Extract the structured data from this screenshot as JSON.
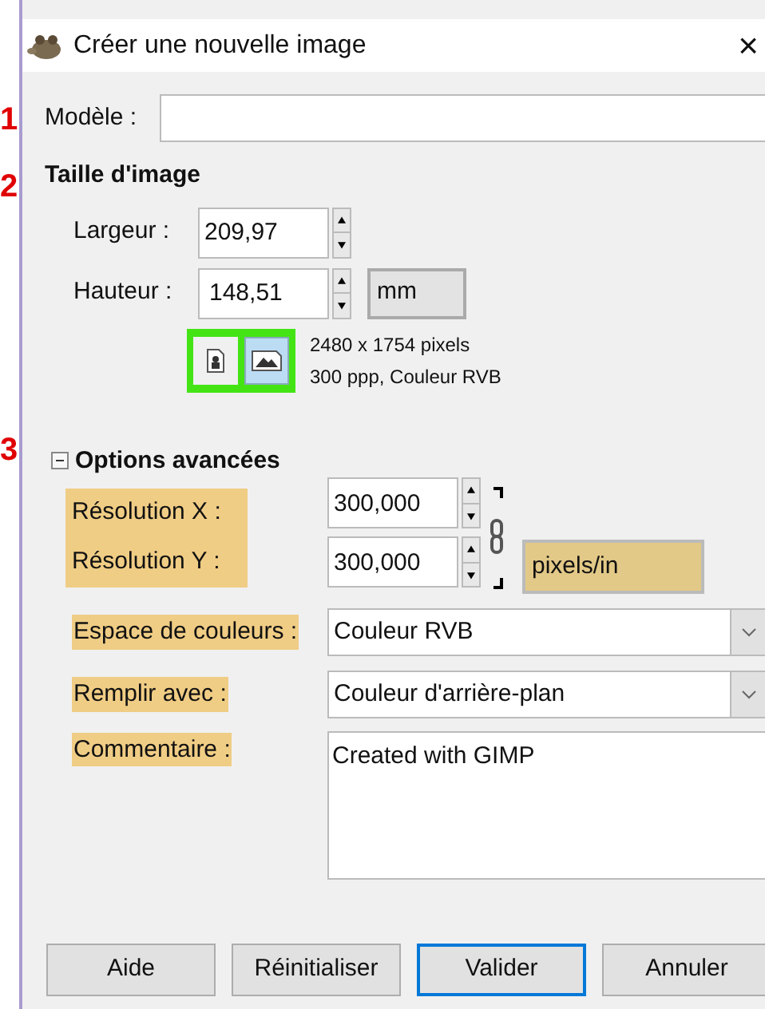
{
  "markers": [
    "1",
    "2",
    "3"
  ],
  "window": {
    "title": "Créer une nouvelle image",
    "close": "×"
  },
  "template": {
    "label": "Modèle :"
  },
  "image_size": {
    "title": "Taille d'image",
    "width": {
      "label": "Largeur :",
      "value": "209,97"
    },
    "height": {
      "label": "Hauteur :",
      "value": "148,51"
    },
    "unit": "mm",
    "orientations": [
      {
        "kind": "portrait",
        "selected": false
      },
      {
        "kind": "landscape",
        "selected": true
      }
    ],
    "orientation_highlighted": true,
    "info": [
      "2480 x 1754 pixels",
      "300 ppp, Couleur RVB"
    ]
  },
  "advanced": {
    "title": "Options avancées",
    "expanded": true,
    "resolution_x": {
      "label": "Résolution X :",
      "value": "300,000"
    },
    "resolution_y": {
      "label": "Résolution Y :",
      "value": "300,000"
    },
    "resolution_highlighted": true,
    "resolution_unit": {
      "value": "pixels/in",
      "highlighted": true
    },
    "color_space": {
      "label": "Espace de couleurs :",
      "value": "Couleur RVB",
      "highlighted": true
    },
    "fill": {
      "label": "Remplir avec :",
      "value": "Couleur d'arrière-plan",
      "highlighted": true
    },
    "comment": {
      "label": "Commentaire :",
      "value": "Created with GIMP",
      "highlighted": true
    }
  },
  "buttons": [
    {
      "label": "Aide",
      "default": false
    },
    {
      "label": "Réinitialiser",
      "default": false
    },
    {
      "label": "Valider",
      "default": true
    },
    {
      "label": "Annuler",
      "default": false
    }
  ]
}
